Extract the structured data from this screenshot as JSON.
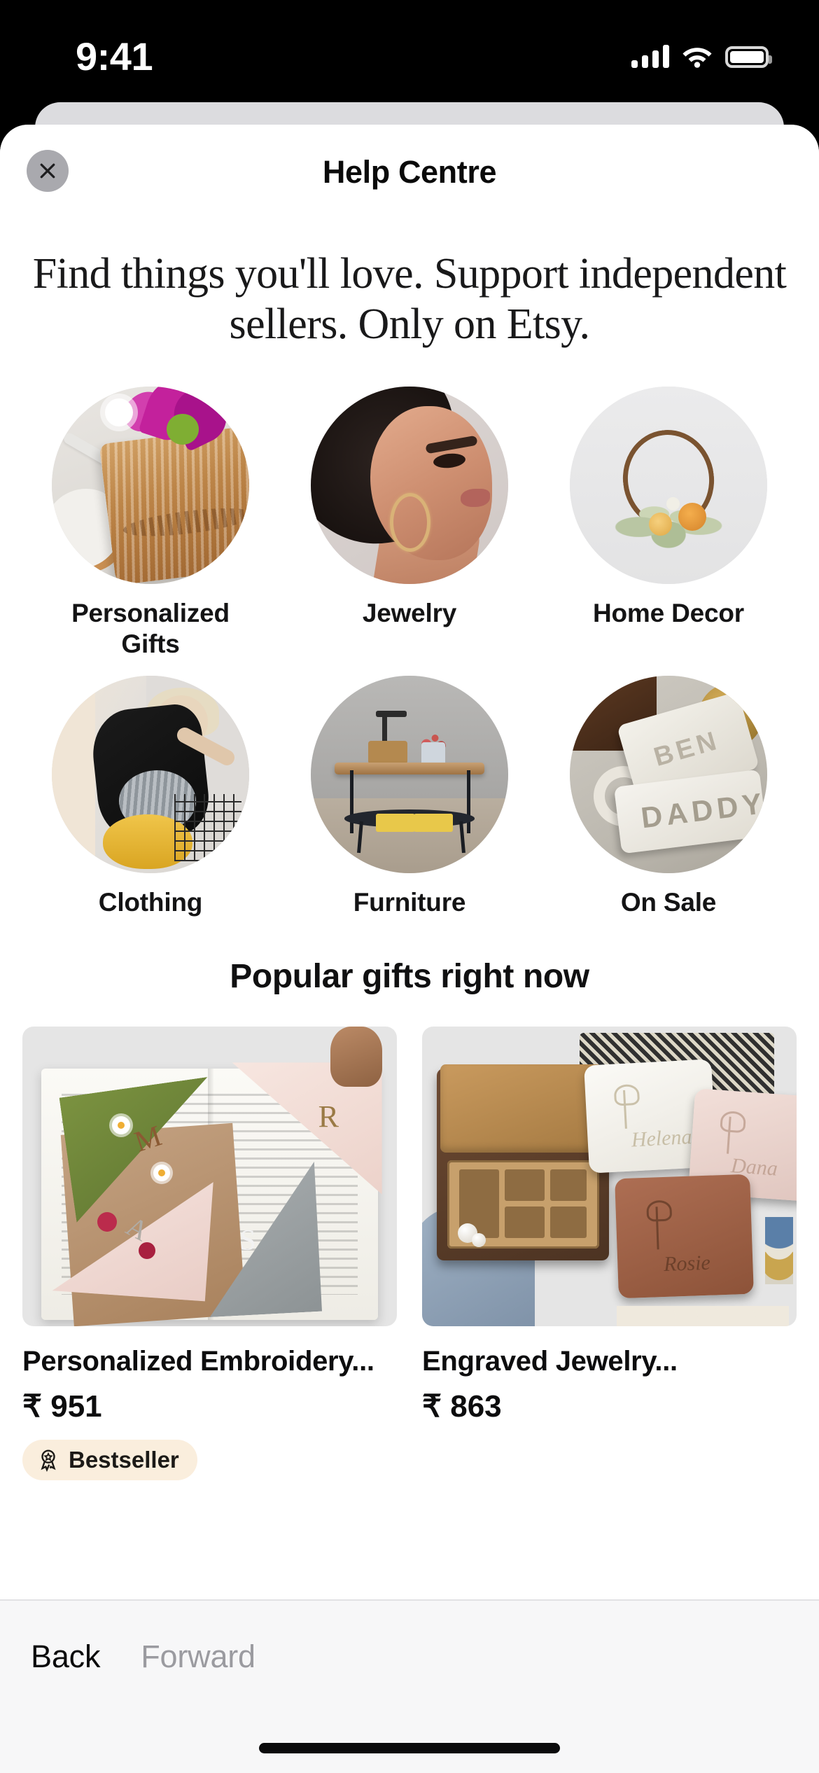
{
  "status_bar": {
    "time": "9:41",
    "cellular_icon": "cellular-signal-icon",
    "wifi_icon": "wifi-icon",
    "battery_icon": "battery-icon"
  },
  "header": {
    "title": "Help Centre",
    "close_icon": "close-icon"
  },
  "hero": {
    "headline": "Find things you'll love. Support independent sellers. Only on Etsy."
  },
  "categories": [
    {
      "label": "Personalized Gifts",
      "image": "engraved-olive-wood-board-with-flowers"
    },
    {
      "label": "Jewelry",
      "image": "woman-profile-wearing-gold-hoop-earring"
    },
    {
      "label": "Home Decor",
      "image": "dried-flower-twig-wreath"
    },
    {
      "label": "Clothing",
      "image": "model-in-black-dress"
    },
    {
      "label": "Furniture",
      "image": "wooden-console-table"
    },
    {
      "label": "On Sale",
      "image": "concrete-name-keepsakes"
    }
  ],
  "popular": {
    "section_title": "Popular gifts right now",
    "products": [
      {
        "title": "Personalized Embroidery...",
        "price": "₹ 951",
        "image": "embroidered-corner-bookmarks-on-open-book",
        "badge": {
          "label": "Bestseller",
          "icon": "award-ribbon-icon"
        },
        "letters": {
          "green": "M",
          "pink": "A",
          "blush": "R",
          "grey": "S"
        }
      },
      {
        "title": "Engraved Jewelry...",
        "price": "₹ 863",
        "image": "engraved-personalized-jewelry-boxes",
        "badge": null,
        "engraved_names": {
          "white": "Helena",
          "pink": "Dana",
          "brown": "Rosie"
        }
      }
    ]
  },
  "toolbar": {
    "back_label": "Back",
    "forward_label": "Forward"
  },
  "colors": {
    "badge_background": "#faeedd",
    "toolbar_background": "#f7f7f8",
    "close_button_background": "#a9a9ae",
    "disabled_text": "#9b9ba0",
    "text_primary": "#0d0d0e"
  },
  "sale_tiles": {
    "top": "BEN",
    "bottom": "DADDY"
  }
}
